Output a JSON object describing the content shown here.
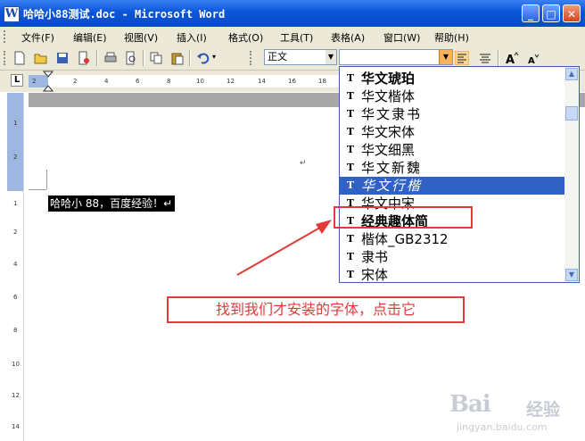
{
  "window": {
    "title": "哈哈小88测试.doc - Microsoft Word"
  },
  "menu": [
    "文件(F)",
    "编辑(E)",
    "视图(V)",
    "插入(I)",
    "格式(O)",
    "工具(T)",
    "表格(A)",
    "窗口(W)",
    "帮助(H)"
  ],
  "toolbar": {
    "style_value": "正文",
    "font_value": ""
  },
  "ruler": {
    "h_ticks": [
      "2",
      "2",
      "4",
      "6",
      "8",
      "10",
      "12",
      "14",
      "16",
      "18"
    ],
    "v_ticks": [
      "1",
      "2",
      "1",
      "2",
      "4",
      "6",
      "8",
      "10",
      "12",
      "14"
    ]
  },
  "document": {
    "mark": "↵",
    "selected_text": "哈哈小 88，百度经验！↵"
  },
  "font_list": {
    "items": [
      "华文琥珀",
      "华文楷体",
      "华文隶书",
      "华文宋体",
      "华文细黑",
      "华文新魏",
      "华文行楷",
      "华文中宋",
      "经典趣体简",
      "楷体_GB2312",
      "隶书",
      "宋体"
    ],
    "selected": "华文行楷",
    "highlighted": "经典趣体简"
  },
  "annotation": {
    "text": "找到我们才安装的字体，点击它",
    "color": "#e23a3a"
  },
  "watermark": {
    "brand": "Bai",
    "jingyan": "经验",
    "url": "jingyan.baidu.com"
  },
  "colors": {
    "titlebar": "#0a55d8",
    "selection": "#3061c4",
    "annotation": "#e23a3a"
  }
}
